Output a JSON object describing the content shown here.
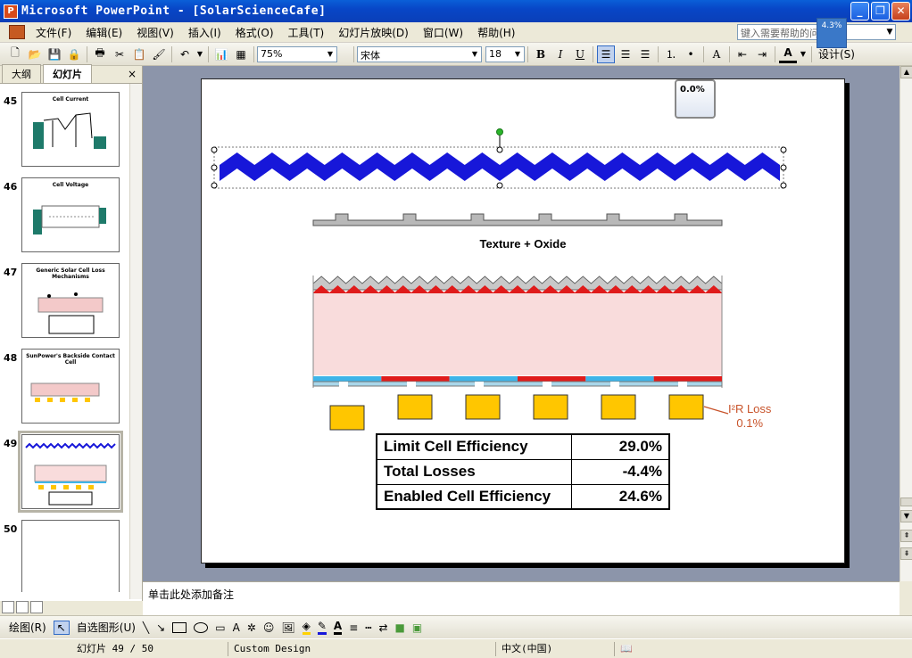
{
  "window": {
    "title": "Microsoft PowerPoint - [SolarScienceCafe]",
    "zoom_badge": "4.3%"
  },
  "menu": {
    "items": [
      "文件(F)",
      "编辑(E)",
      "视图(V)",
      "插入(I)",
      "格式(O)",
      "工具(T)",
      "幻灯片放映(D)",
      "窗口(W)",
      "帮助(H)"
    ],
    "help_placeholder": "键入需要帮助的问题"
  },
  "toolbar": {
    "zoom": "75%",
    "font": "宋体",
    "font_size": "18",
    "bold": "B",
    "italic": "I",
    "underline": "U",
    "design": "设计(S)"
  },
  "sidepane": {
    "tab_outline": "大纲",
    "tab_slides": "幻灯片",
    "close": "×",
    "thumbnails": [
      {
        "number": "45",
        "title": "Cell Current"
      },
      {
        "number": "46",
        "title": "Cell Voltage"
      },
      {
        "number": "47",
        "title": "Generic Solar Cell Loss Mechanisms"
      },
      {
        "number": "48",
        "title": "SunPower's Backside Contact Cell"
      },
      {
        "number": "49",
        "title": ""
      },
      {
        "number": "50",
        "title": ""
      }
    ],
    "selected_index": 4
  },
  "slide": {
    "percent_box": "0.0%",
    "texture_label": "Texture + Oxide",
    "loss_label_line1": "I²R Loss",
    "loss_label_line2": "0.1%",
    "table": [
      {
        "label": "Limit Cell Efficiency",
        "value": "29.0%"
      },
      {
        "label": "Total Losses",
        "value": "-4.4%"
      },
      {
        "label": "Enabled Cell Efficiency",
        "value": "24.6%"
      }
    ],
    "colors": {
      "zigzag": "#1717d9",
      "substrate": "#f9dcdc",
      "pad": "#ffc600",
      "contact_blue": "#3fb4e8",
      "contact_red": "#e01b1b",
      "loss_text": "#c8532a"
    }
  },
  "notes": {
    "placeholder": "单击此处添加备注"
  },
  "drawbar": {
    "draw": "绘图(R)",
    "autoshapes": "自选图形(U)"
  },
  "status": {
    "slide_pos": "幻灯片 49 / 50",
    "design": "Custom Design",
    "language": "中文(中国)"
  }
}
